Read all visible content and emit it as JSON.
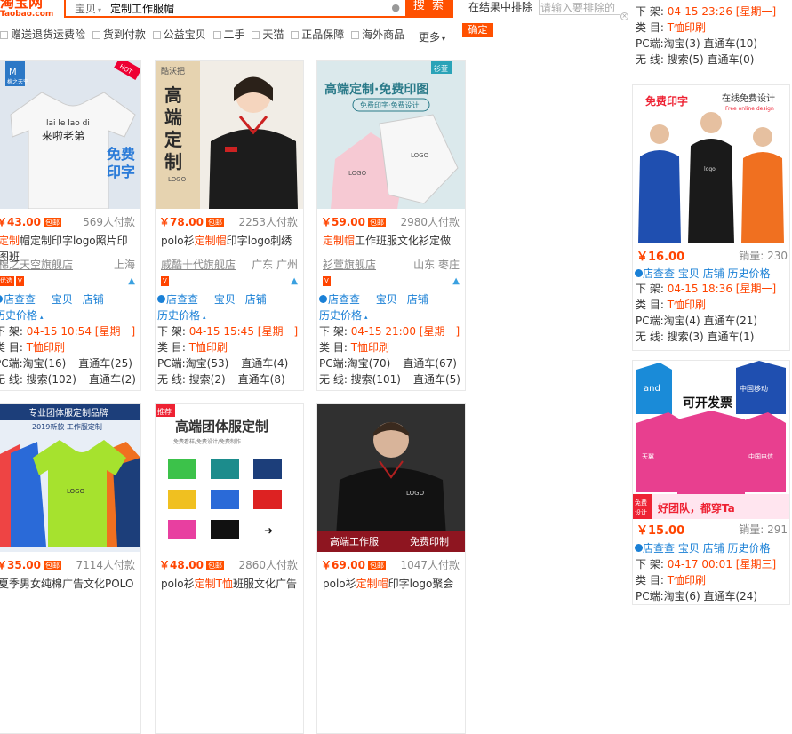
{
  "header": {
    "logo_cn": "淘宝网",
    "logo_en": "Taobao.com",
    "search_category": "宝贝",
    "search_query": "定制工作服帽",
    "search_button": "搜 索",
    "within_results_label": "在结果中排除",
    "exclude_placeholder": "请输入要排除的",
    "confirm_button": "确定",
    "more_label": "更多"
  },
  "filters": [
    "赠送退货运费险",
    "货到付款",
    "公益宝贝",
    "二手",
    "天猫",
    "正品保障",
    "海外商品"
  ],
  "products": [
    {
      "price": "￥43.00",
      "price_badge": "包邮",
      "deals": "569人付款",
      "title_pre": "",
      "title_hl": "定制",
      "title_post": "帽定制印字logo照片印图班",
      "shop": "棉之天空旗舰店",
      "location": "上海",
      "links": [
        "店查查",
        "宝贝",
        "店铺"
      ],
      "history": "历史价格",
      "listed": "下 架: ",
      "listed_time": "04-15 10:54 [星期一]",
      "category": "类 目: ",
      "category_value": "T恤印刷",
      "pc": "PC端:淘宝(16)",
      "pc_zhitong": "直通车(25)",
      "mobile": "无 线: 搜索(102)",
      "mobile_zhitong": "直通车(2)",
      "image": "white-tshirt-print",
      "overlay_text": "lai le lao di 来啦老弟",
      "overlay_side": "免费印字",
      "brand_tag": "棉之天空",
      "hot_tag": "HOT"
    },
    {
      "price": "￥78.00",
      "price_badge": "包邮",
      "deals": "2253人付款",
      "title_pre": "polo衫",
      "title_hl": "定制帽",
      "title_post": "印字logo刺绣",
      "shop": "戚酷十代旗舰店",
      "location": "广东 广州",
      "links": [
        "店查查",
        "宝贝",
        "店铺"
      ],
      "history": "历史价格",
      "listed": "下 架: ",
      "listed_time": "04-15 15:45 [星期一]",
      "category": "类 目: ",
      "category_value": "T恤印刷",
      "pc": "PC端:淘宝(53)",
      "pc_zhitong": "直通车(4)",
      "mobile": "无 线: 搜索(2)",
      "mobile_zhitong": "直通车(8)",
      "image": "black-polo-woman",
      "overlay_text": "高端定制",
      "overlay_side": "LOGO",
      "brand_tag": "酷沃把"
    },
    {
      "price": "￥59.00",
      "price_badge": "包邮",
      "deals": "2980人付款",
      "title_pre": "",
      "title_hl": "定制帽",
      "title_post": "工作班服文化衫定做",
      "shop": "衫萱旗舰店",
      "location": "山东 枣庄",
      "links": [
        "店查查",
        "宝贝",
        "店铺"
      ],
      "history": "历史价格",
      "listed": "下 架: ",
      "listed_time": "04-15 21:00 [星期一]",
      "category": "类 目: ",
      "category_value": "T恤印刷",
      "pc": "PC端:淘宝(70)",
      "pc_zhitong": "直通车(67)",
      "mobile": "无 线: 搜索(101)",
      "mobile_zhitong": "直通车(5)",
      "image": "pink-white-tshirts",
      "overlay_text": "高端定制·免费印图",
      "overlay_side": "免费印字·免费设计",
      "brand_tag": "衫萱"
    },
    {
      "price": "￥35.00",
      "price_badge": "包邮",
      "deals": "7114人付款",
      "title_pre": "夏季男女纯棉广告文化POLO",
      "title_hl": "",
      "title_post": "",
      "image": "colorful-polos",
      "overlay_text": "专业团体服定制品牌",
      "overlay_side": "2019新款 工作服定制"
    },
    {
      "price": "￥48.00",
      "price_badge": "包邮",
      "deals": "2860人付款",
      "title_pre": "polo衫",
      "title_hl": "定制T恤",
      "title_post": "班服文化广告",
      "image": "polo-grid",
      "overlay_text": "高端团体服定制",
      "overlay_side": "免费看样/免费设计/免费制作",
      "hot_tag": "推荐"
    },
    {
      "price": "￥69.00",
      "price_badge": "包邮",
      "deals": "1047人付款",
      "title_pre": "polo衫",
      "title_hl": "定制帽",
      "title_post": "印字logo聚会",
      "image": "black-polo-man",
      "overlay_text": "高端工作服",
      "overlay_side": "免费印制"
    }
  ],
  "sidebar": {
    "top_info": {
      "listed": "下 架: ",
      "listed_time": "04-15 23:26 [星期一]",
      "category": "类 目: ",
      "category_value": "T恤印刷",
      "pc": "PC端:淘宝(3) 直通车(10)",
      "mobile": "无 线: 搜索(5) 直通车(0)"
    },
    "ads": [
      {
        "price": "￥16.00",
        "sales": "销量: 230",
        "image": "team-polos",
        "overlay_text": "免费印字",
        "overlay_side": "在线免费设计",
        "links": [
          "店查查",
          "宝贝",
          "店铺",
          "历史价格"
        ],
        "listed": "下 架: ",
        "listed_time": "04-15 18:36 [星期一]",
        "category": "类 目: ",
        "category_value": "T恤印刷",
        "pc": "PC端:淘宝(4) 直通车(21)",
        "mobile": "无 线: 搜索(3) 直通车(1)"
      },
      {
        "price": "￥15.00",
        "sales": "销量: 291",
        "image": "telecom-polos",
        "overlay_text": "可开发票",
        "overlay_side": "好团队，都穿Ta",
        "links": [
          "店查查",
          "宝贝",
          "店铺",
          "历史价格"
        ],
        "listed": "下 架: ",
        "listed_time": "04-17 00:01 [星期三]",
        "category": "类 目: ",
        "category_value": "T恤印刷",
        "pc": "PC端:淘宝(6) 直通车(24)"
      }
    ]
  },
  "colors": {
    "accent": "#ff5000",
    "link": "#1a80d6",
    "price": "#ff4400"
  }
}
